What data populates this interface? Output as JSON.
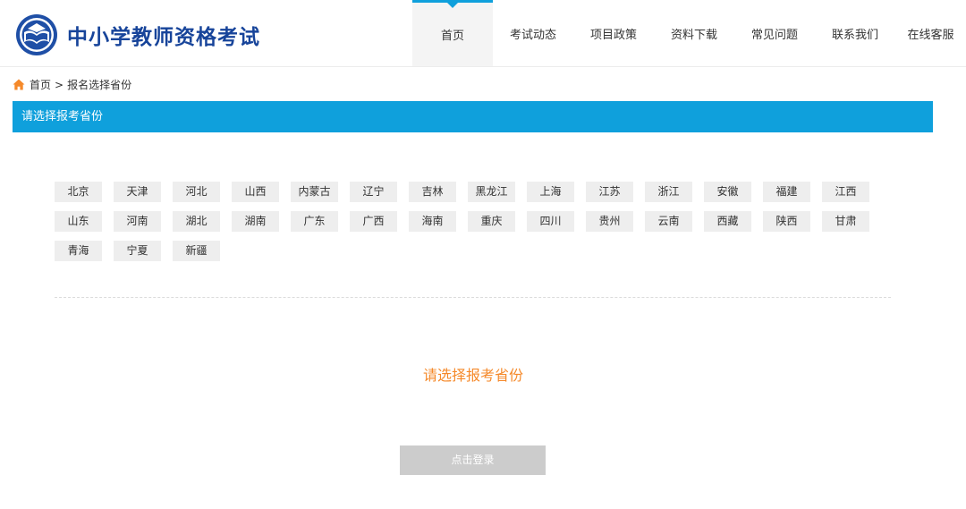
{
  "brand": {
    "title": "中小学教师资格考试",
    "logo_icon": "exam-seal-logo"
  },
  "nav": {
    "active_index": 0,
    "accent": "#0fa0dc",
    "items": [
      {
        "label": "首页"
      },
      {
        "label": "考试动态"
      },
      {
        "label": "项目政策"
      },
      {
        "label": "资料下载"
      },
      {
        "label": "常见问题"
      },
      {
        "label": "联系我们"
      },
      {
        "label": "在线客服"
      }
    ]
  },
  "breadcrumb": {
    "home": "首页",
    "separator": ">",
    "current": "报名选择省份",
    "icon": "home-icon",
    "icon_color": "#f5892a"
  },
  "section": {
    "title": "请选择报考省份",
    "color": "#0fa0dc"
  },
  "provinces": [
    "北京",
    "天津",
    "河北",
    "山西",
    "内蒙古",
    "辽宁",
    "吉林",
    "黑龙江",
    "上海",
    "江苏",
    "浙江",
    "安徽",
    "福建",
    "江西",
    "山东",
    "河南",
    "湖北",
    "湖南",
    "广东",
    "广西",
    "海南",
    "重庆",
    "四川",
    "贵州",
    "云南",
    "西藏",
    "陕西",
    "甘肃",
    "青海",
    "宁夏",
    "新疆"
  ],
  "prompt": {
    "text": "请选择报考省份",
    "color": "#f5892a"
  },
  "login_button": {
    "label": "点击登录"
  }
}
